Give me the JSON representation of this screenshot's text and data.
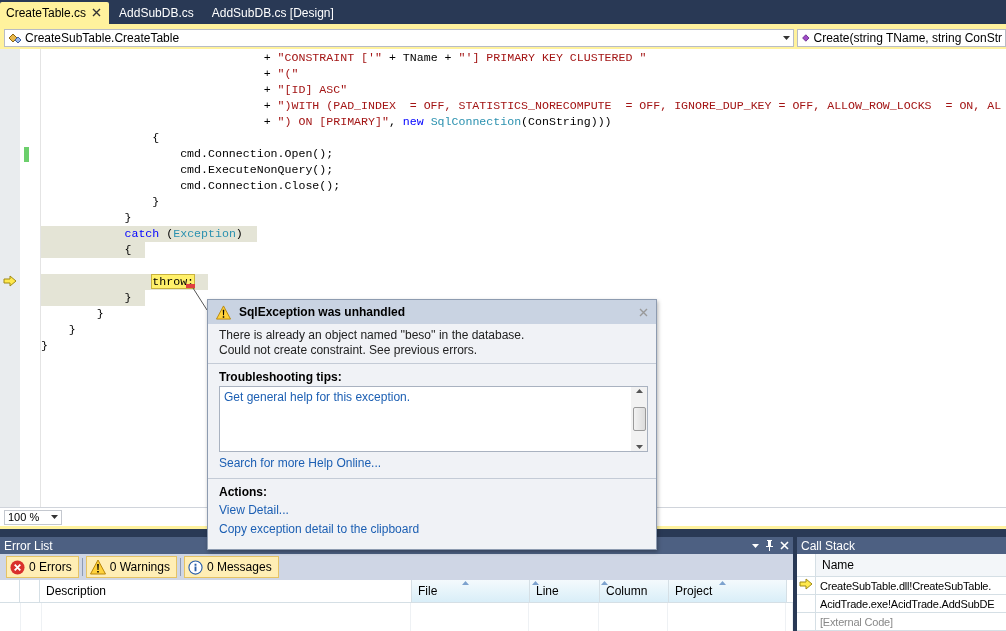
{
  "tabs": [
    {
      "label": "CreateTable.cs",
      "selected": true
    },
    {
      "label": "AddSubDB.cs",
      "selected": false
    },
    {
      "label": "AddSubDB.cs [Design]",
      "selected": false
    }
  ],
  "nav": {
    "type_dropdown": "CreateSubTable.CreateTable",
    "member_dropdown": "Create(string TName, string ConStr"
  },
  "editor": {
    "lines": [
      {
        "highlight": false,
        "current": false,
        "changed": false,
        "segments": [
          {
            "kind": "plain",
            "text": "                                + "
          },
          {
            "kind": "string",
            "text": "\"CONSTRAINT ['\""
          },
          {
            "kind": "plain",
            "text": " + TName + "
          },
          {
            "kind": "string",
            "text": "\"'] PRIMARY KEY CLUSTERED \""
          }
        ]
      },
      {
        "highlight": false,
        "current": false,
        "changed": false,
        "segments": [
          {
            "kind": "plain",
            "text": "                                + "
          },
          {
            "kind": "string",
            "text": "\"(\""
          }
        ]
      },
      {
        "highlight": false,
        "current": false,
        "changed": false,
        "segments": [
          {
            "kind": "plain",
            "text": "                                + "
          },
          {
            "kind": "string",
            "text": "\"[ID] ASC\""
          }
        ]
      },
      {
        "highlight": false,
        "current": false,
        "changed": false,
        "segments": [
          {
            "kind": "plain",
            "text": "                                + "
          },
          {
            "kind": "string",
            "text": "\")WITH (PAD_INDEX  = OFF, STATISTICS_NORECOMPUTE  = OFF, IGNORE_DUP_KEY = OFF, ALLOW_ROW_LOCKS  = ON, AL"
          }
        ]
      },
      {
        "highlight": false,
        "current": false,
        "changed": false,
        "segments": [
          {
            "kind": "plain",
            "text": "                                + "
          },
          {
            "kind": "string",
            "text": "\") ON [PRIMARY]\""
          },
          {
            "kind": "plain",
            "text": ", "
          },
          {
            "kind": "keyword",
            "text": "new"
          },
          {
            "kind": "type",
            "text": " SqlConnection"
          },
          {
            "kind": "plain",
            "text": "(ConString)))"
          }
        ]
      },
      {
        "highlight": false,
        "current": false,
        "changed": false,
        "segments": [
          {
            "kind": "plain",
            "text": "                {"
          }
        ]
      },
      {
        "highlight": false,
        "current": false,
        "changed": true,
        "segments": [
          {
            "kind": "plain",
            "text": "                    cmd.Connection.Open();"
          }
        ]
      },
      {
        "highlight": false,
        "current": false,
        "changed": false,
        "segments": [
          {
            "kind": "plain",
            "text": "                    cmd.ExecuteNonQuery();"
          }
        ]
      },
      {
        "highlight": false,
        "current": false,
        "changed": false,
        "segments": [
          {
            "kind": "plain",
            "text": "                    cmd.Connection.Close();"
          }
        ]
      },
      {
        "highlight": false,
        "current": false,
        "changed": false,
        "segments": [
          {
            "kind": "plain",
            "text": "                }"
          }
        ]
      },
      {
        "highlight": false,
        "current": false,
        "changed": false,
        "segments": [
          {
            "kind": "plain",
            "text": "            }"
          }
        ]
      },
      {
        "highlight": true,
        "current": false,
        "changed": false,
        "segments": [
          {
            "kind": "keyword",
            "text": "            catch"
          },
          {
            "kind": "plain",
            "text": " ("
          },
          {
            "kind": "type",
            "text": "Exception"
          },
          {
            "kind": "plain",
            "text": ")"
          }
        ]
      },
      {
        "highlight": true,
        "current": false,
        "changed": false,
        "segments": [
          {
            "kind": "plain",
            "text": "            {"
          }
        ]
      },
      {
        "highlight": false,
        "current": false,
        "changed": false
      },
      {
        "highlight": true,
        "current": true,
        "changed": false,
        "segments": [
          {
            "kind": "statement",
            "text": "                throw;"
          }
        ]
      },
      {
        "highlight": true,
        "current": false,
        "changed": false,
        "segments": [
          {
            "kind": "plain",
            "text": "            }"
          }
        ]
      },
      {
        "highlight": false,
        "current": false,
        "changed": false,
        "segments": [
          {
            "kind": "plain",
            "text": "        }"
          }
        ]
      },
      {
        "highlight": false,
        "current": false,
        "changed": false,
        "segments": [
          {
            "kind": "plain",
            "text": "    }"
          }
        ]
      },
      {
        "highlight": false,
        "current": false,
        "changed": false,
        "segments": [
          {
            "kind": "plain",
            "text": "}"
          }
        ]
      }
    ],
    "zoom": "100 %"
  },
  "exception": {
    "title": "SqlException was unhandled",
    "message": [
      "There is already an object named ''beso'' in the database.",
      "Could not create constraint. See previous errors."
    ],
    "tips_heading": "Troubleshooting tips:",
    "tips": [
      "Get general help for this exception."
    ],
    "search_link": "Search for more Help Online...",
    "actions_heading": "Actions:",
    "actions": [
      "View Detail...",
      "Copy exception detail to the clipboard"
    ]
  },
  "error_list": {
    "title": "Error List",
    "filters": [
      {
        "kind": "error",
        "label": "0 Errors",
        "selected": true
      },
      {
        "kind": "warning",
        "label": "0 Warnings",
        "selected": true
      },
      {
        "kind": "info",
        "label": "0 Messages",
        "selected": true
      }
    ],
    "columns": [
      {
        "label": "Description",
        "sortable": false
      },
      {
        "label": "File",
        "sortable": true
      },
      {
        "label": "Line",
        "sortable": true
      },
      {
        "label": "Column",
        "sortable": true
      },
      {
        "label": "Project",
        "sortable": true
      }
    ]
  },
  "call_stack": {
    "title": "Call Stack",
    "column": "Name",
    "rows": [
      {
        "text": "CreateSubTable.dll!CreateSubTable.",
        "current": true,
        "external": false
      },
      {
        "text": "AcidTrade.exe!AcidTrade.AddSubDE",
        "current": false,
        "external": false
      },
      {
        "text": "[External Code]",
        "current": false,
        "external": true
      }
    ]
  }
}
